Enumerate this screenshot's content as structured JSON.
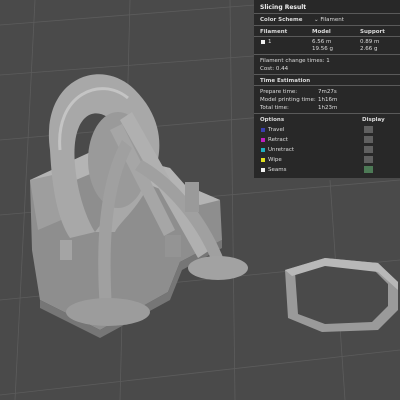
{
  "panel": {
    "title": "Slicing Result",
    "color_scheme_label": "Color Scheme",
    "color_scheme_value": "Filament",
    "filament_table": {
      "headers": [
        "Filament",
        "Model",
        "Support"
      ],
      "row": {
        "index": "1",
        "model_length": "6.56 m",
        "model_weight": "19.56 g",
        "support_length": "0.89 m",
        "support_weight": "2.66 g"
      }
    },
    "filament_change_times": "Filament change times:  1",
    "cost": "Cost:  0.44",
    "time_estimation_title": "Time Estimation",
    "times": [
      {
        "label": "Prepare time:",
        "value": "7m27s"
      },
      {
        "label": "Model printing time:",
        "value": "1h16m"
      },
      {
        "label": "Total time:",
        "value": "1h23m"
      }
    ],
    "options_header": "Options",
    "display_header": "Display",
    "options": [
      {
        "label": "Travel",
        "color": "#3a3fb0"
      },
      {
        "label": "Retract",
        "color": "#c020c0"
      },
      {
        "label": "Unretract",
        "color": "#20b0c0"
      },
      {
        "label": "Wipe",
        "color": "#e0e020"
      },
      {
        "label": "Seams",
        "color": "#f0f0f0"
      }
    ],
    "display_color_on": "#4d7a56",
    "display_color_off": "#606060"
  }
}
